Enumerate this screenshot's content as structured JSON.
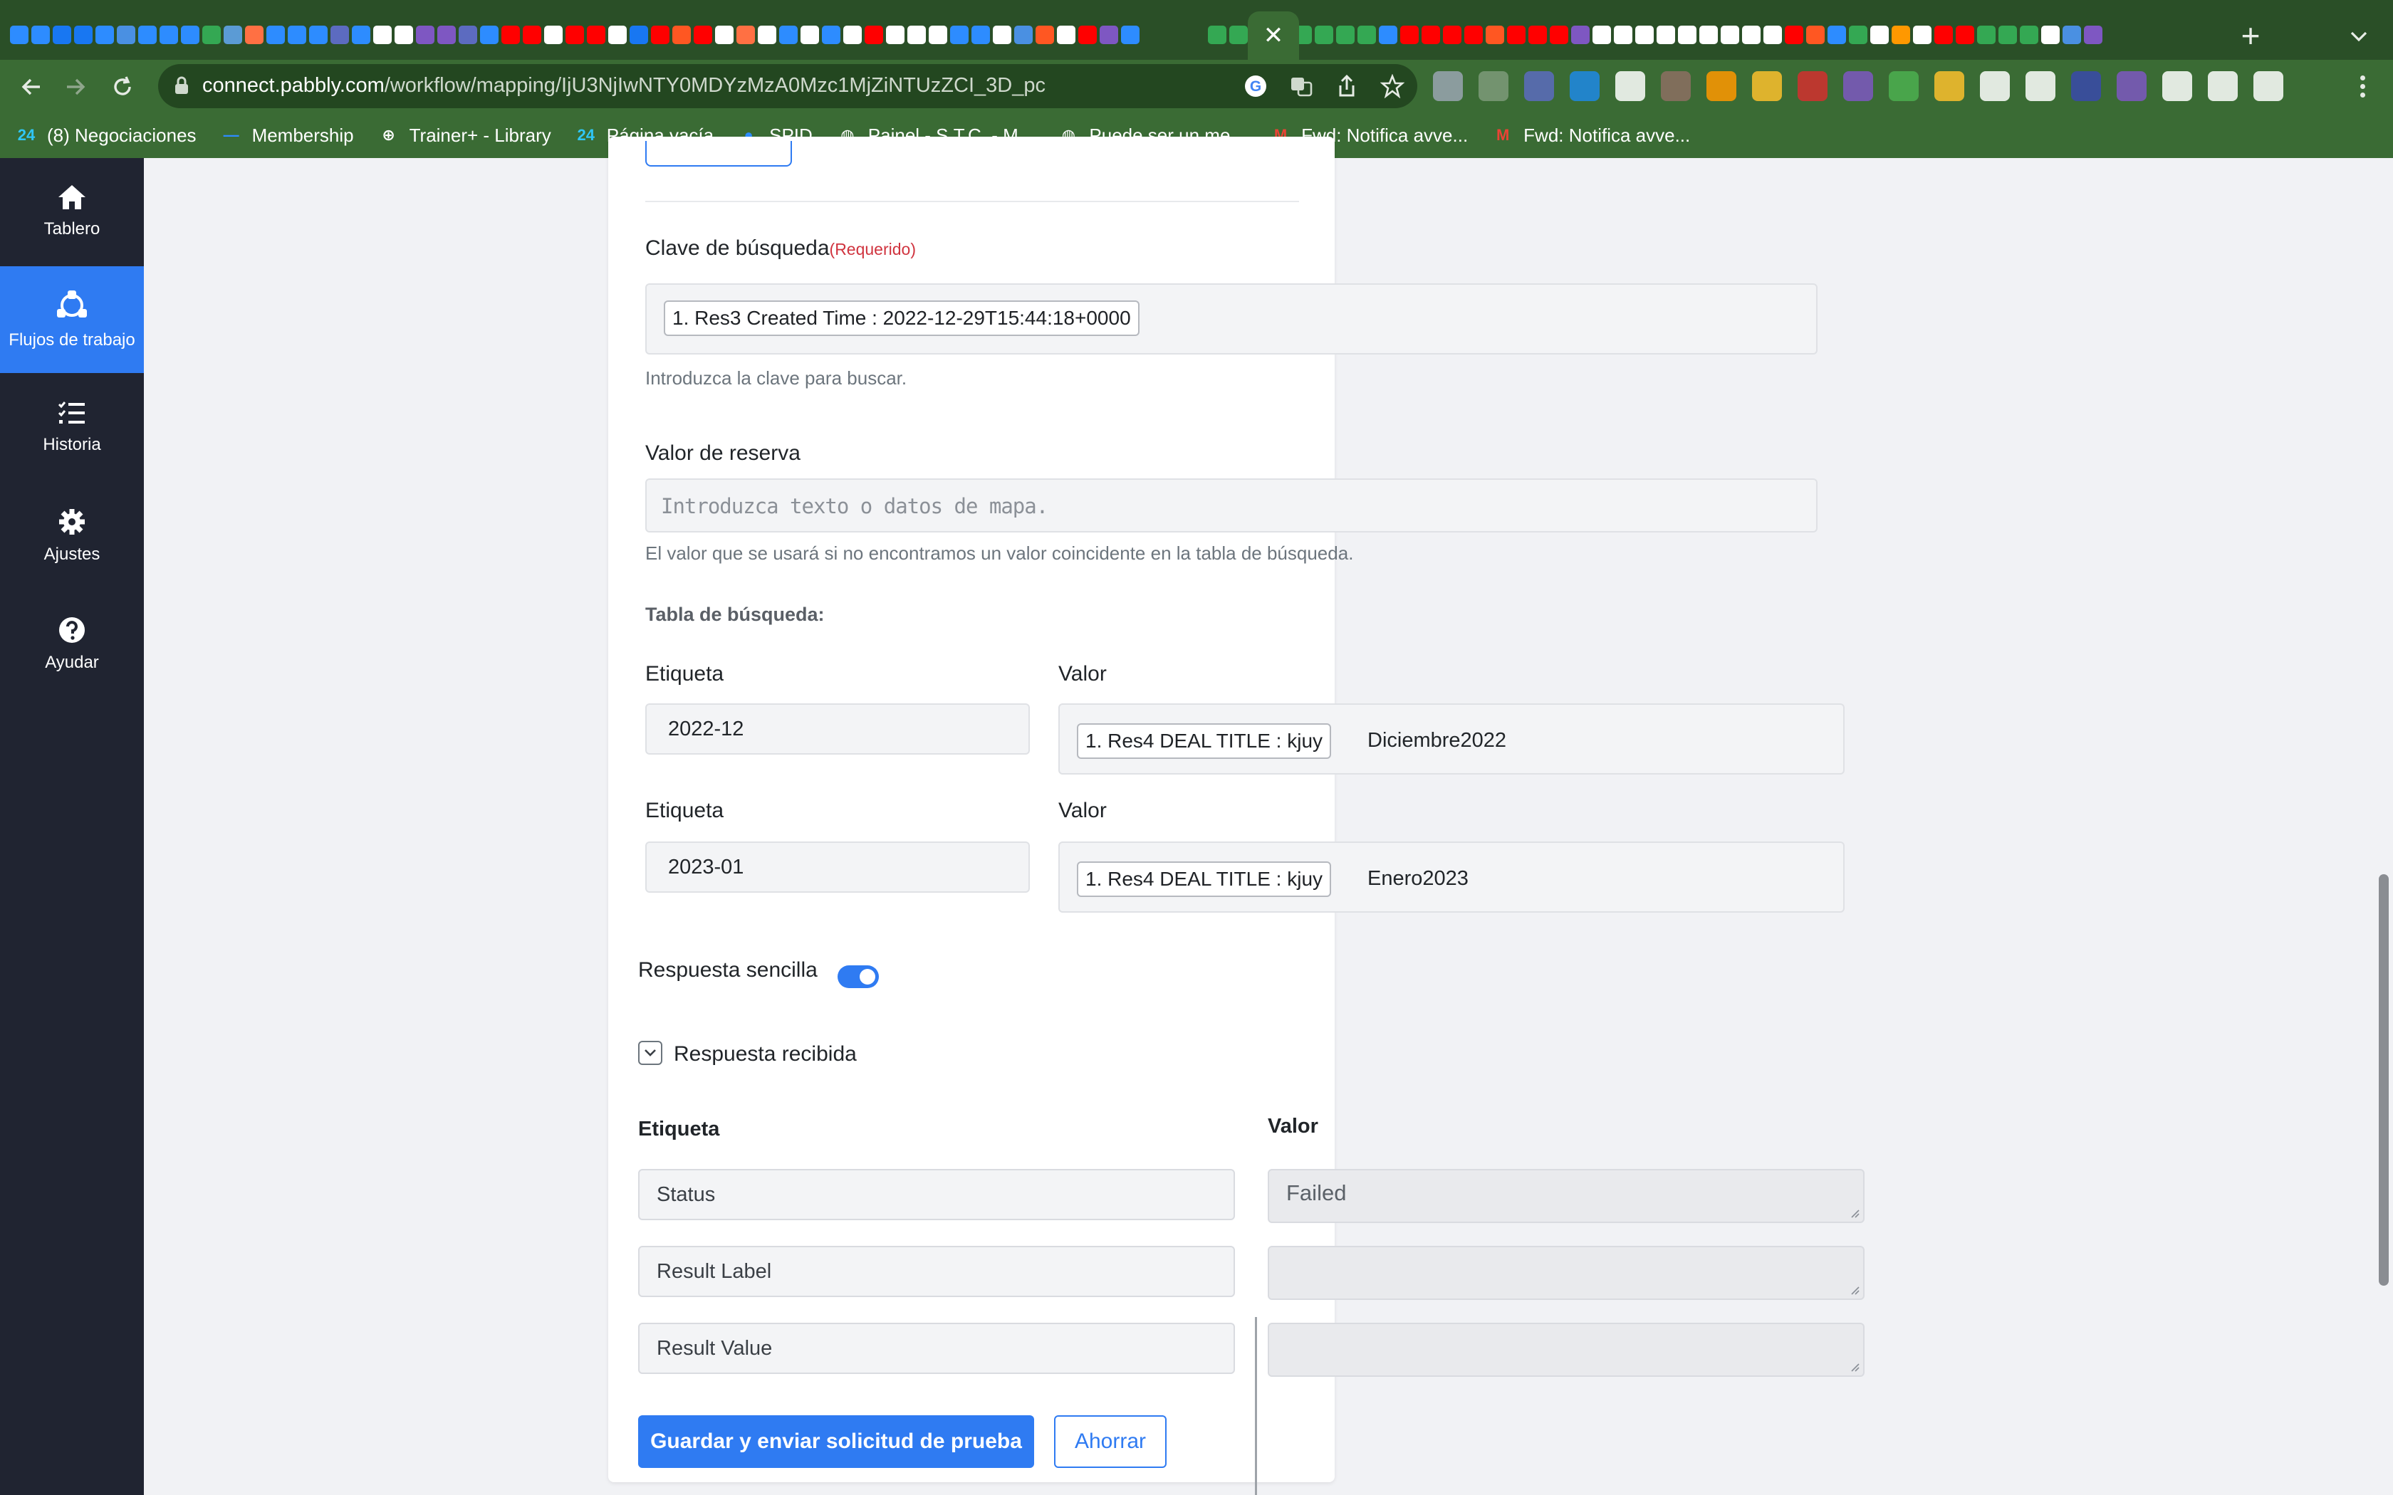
{
  "browser": {
    "url_host": "connect.pabbly.com",
    "url_path": "/workflow/mapping/IjU3NjIwNTY0MDYzMzA0Mzc1MjZiNTUzZCI_3D_pc",
    "active_tab_close": "✕",
    "new_tab": "+",
    "tab_favicon_colors": [
      "#2d8cff",
      "#2d8cff",
      "#1877f2",
      "#1877f2",
      "#2d8cff",
      "#4a90e2",
      "#2d8cff",
      "#2d8cff",
      "#2d8cff",
      "#34a853",
      "#5b9bd5",
      "#ff7043",
      "#2d8cff",
      "#2d8cff",
      "#2d8cff",
      "#5c6bc0",
      "#2d8cff",
      "#ffffff",
      "#ffffff",
      "#7e57c2",
      "#7e57c2",
      "#5c6bc0",
      "#2d8cff",
      "#ff0000",
      "#ff0000",
      "#ffffff",
      "#ff0000",
      "#ff0000",
      "#ffffff",
      "#1877f2",
      "#ff0000",
      "#ff5722",
      "#ff0000",
      "#ffffff",
      "#ff7043",
      "#ffffff",
      "#2d8cff",
      "#ffffff",
      "#2d8cff",
      "#ffffff",
      "#ff0000",
      "#ffffff",
      "#ffffff",
      "#ffffff",
      "#2d8cff",
      "#2d8cff",
      "#ffffff",
      "#4a90e2",
      "#ff5722",
      "#ffffff",
      "#ff0000",
      "#7e57c2",
      "#2d8cff"
    ],
    "tab_favicon_colors_right": [
      "#34a853",
      "#34a853",
      "#ff0000",
      "#1877f2",
      "#34a853",
      "#34a853",
      "#34a853",
      "#34a853",
      "#2d8cff",
      "#ff0000",
      "#ff0000",
      "#ff0000",
      "#ff0000",
      "#ff5722",
      "#ff0000",
      "#ff0000",
      "#ff0000",
      "#7e57c2",
      "#ffffff",
      "#ffffff",
      "#ffffff",
      "#ffffff",
      "#ffffff",
      "#ffffff",
      "#ffffff",
      "#ffffff",
      "#ffffff",
      "#ff0000",
      "#ff5722",
      "#2d8cff",
      "#34a853",
      "#ffffff",
      "#ff9800",
      "#ffffff",
      "#ff0000",
      "#ff0000",
      "#34a853",
      "#34a853",
      "#34a853",
      "#ffffff",
      "#4a90e2",
      "#7e57c2"
    ],
    "extension_colors": [
      "#9aa5b1",
      "#7e9a7a",
      "#5c6bc0",
      "#1e88e5",
      "#ffffff",
      "#8d6e63",
      "#ff9800",
      "#fbc02d",
      "#d32f2f",
      "#7e57c2",
      "#4caf50",
      "#fbc02d",
      "#ffffff",
      "#ffffff",
      "#3949ab",
      "#7e57c2",
      "#ffffff",
      "#ffffff",
      "#ffffff"
    ]
  },
  "bookmarks": [
    {
      "icon": "bitrix24-icon",
      "color": "#2fc6f6",
      "label": "(8) Negociaciones"
    },
    {
      "icon": "dash-icon",
      "color": "#2d8cff",
      "label": "Membership"
    },
    {
      "icon": "plus-circle-icon",
      "color": "#ffffff",
      "label": "Trainer+ - Library"
    },
    {
      "icon": "bitrix24-icon",
      "color": "#2fc6f6",
      "label": "Página vacía"
    },
    {
      "icon": "user-icon",
      "color": "#2d8cff",
      "label": "SPID"
    },
    {
      "icon": "globe-icon",
      "color": "#ffffff",
      "label": "Painel - S.T.C. - M..."
    },
    {
      "icon": "globe-icon",
      "color": "#ffffff",
      "label": "Puede ser un me..."
    },
    {
      "icon": "gmail-icon",
      "color": "#ea4335",
      "label": "Fwd: Notifica avve..."
    },
    {
      "icon": "gmail-icon",
      "color": "#ea4335",
      "label": "Fwd: Notifica avve..."
    }
  ],
  "sidebar": {
    "items": [
      {
        "label": "Tablero",
        "icon": "home-icon",
        "active": false
      },
      {
        "label": "Flujos de trabajo",
        "icon": "workflow-icon",
        "active": true
      },
      {
        "label": "Historia",
        "icon": "list-icon",
        "active": false
      },
      {
        "label": "Ajustes",
        "icon": "gear-icon",
        "active": false
      },
      {
        "label": "Ayudar",
        "icon": "help-icon",
        "active": false
      }
    ]
  },
  "form": {
    "search_key": {
      "label": "Clave de búsqueda",
      "required": "(Requerido)",
      "chip": "1. Res3 Created Time : 2022-12-29T15:44:18+0000",
      "help": "Introduzca la clave para buscar."
    },
    "fallback": {
      "label": "Valor de reserva",
      "placeholder": "Introduzca texto o datos de mapa.",
      "help": "El valor que se usará si no encontramos un valor coincidente en la tabla de búsqueda."
    },
    "lookup_table": {
      "title": "Tabla de búsqueda:",
      "label_header": "Etiqueta",
      "value_header": "Valor",
      "rows": [
        {
          "label": "2022-12",
          "chip": "1. Res4 DEAL TITLE : kjuy",
          "value_text": "Diciembre2022"
        },
        {
          "label": "2023-01",
          "chip": "1. Res4 DEAL TITLE : kjuy",
          "value_text": "Enero2023"
        }
      ]
    },
    "simple_response": {
      "label": "Respuesta sencilla",
      "on": true
    },
    "received": {
      "label": "Respuesta recibida",
      "label_header": "Etiqueta",
      "value_header": "Valor",
      "rows": [
        {
          "label": "Status",
          "value": "Failed"
        },
        {
          "label": "Result Label",
          "value": ""
        },
        {
          "label": "Result Value",
          "value": ""
        }
      ]
    },
    "buttons": {
      "save_test": "Guardar y enviar solicitud de prueba",
      "save": "Ahorrar"
    }
  }
}
